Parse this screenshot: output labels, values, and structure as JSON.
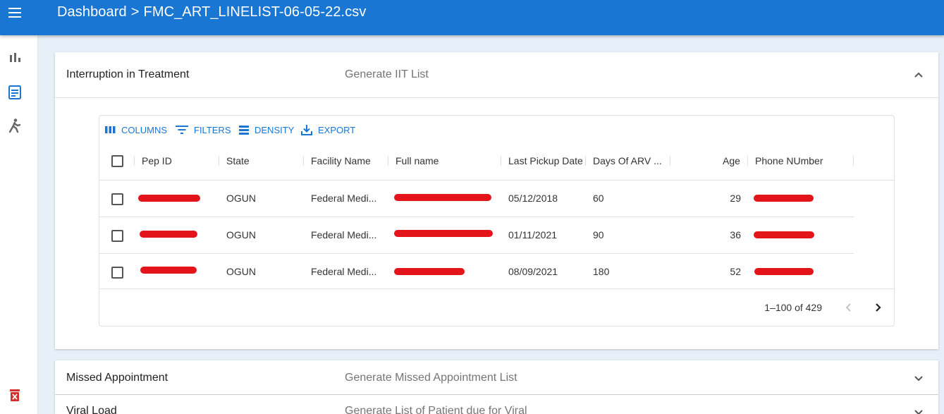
{
  "appbar": {
    "crumb_root": "Dashboard",
    "crumb_sep": ">",
    "crumb_file": "FMC_ART_LINELIST-06-05-22.csv"
  },
  "drawer": {
    "icons": [
      "bar-chart-icon",
      "document-icon",
      "walking-person-icon",
      "delete-bin-icon"
    ]
  },
  "panels": [
    {
      "title": "Interruption in Treatment",
      "description": "Generate IIT List",
      "expanded": true
    },
    {
      "title": "Missed Appointment",
      "description": "Generate Missed Appointment List",
      "expanded": false
    },
    {
      "title": "Viral Load",
      "description": "Generate List of Patient due for Viral",
      "expanded": false
    }
  ],
  "grid": {
    "toolbar": {
      "columns": "COLUMNS",
      "filters": "FILTERS",
      "density": "DENSITY",
      "export": "EXPORT"
    },
    "headers": [
      "Pep ID",
      "State",
      "Facility Name",
      "Full name",
      "Last Pickup Date",
      "Days Of ARV ...",
      "Age",
      "Phone NUmber"
    ],
    "rows": [
      {
        "pep_id": "",
        "state": "OGUN",
        "facility": "Federal Medi...",
        "full_name": "",
        "last_pickup": "05/12/2018",
        "days_arv": "60",
        "age": "29",
        "phone": ""
      },
      {
        "pep_id": "",
        "state": "OGUN",
        "facility": "Federal Medi...",
        "full_name": "",
        "last_pickup": "01/11/2021",
        "days_arv": "90",
        "age": "36",
        "phone": ""
      },
      {
        "pep_id": "",
        "state": "OGUN",
        "facility": "Federal Medi...",
        "full_name": "",
        "last_pickup": "08/09/2021",
        "days_arv": "180",
        "age": "52",
        "phone": ""
      }
    ],
    "pagination": "1–100 of 429"
  },
  "colors": {
    "primary": "#1976d2",
    "redaction": "#e3141a"
  }
}
